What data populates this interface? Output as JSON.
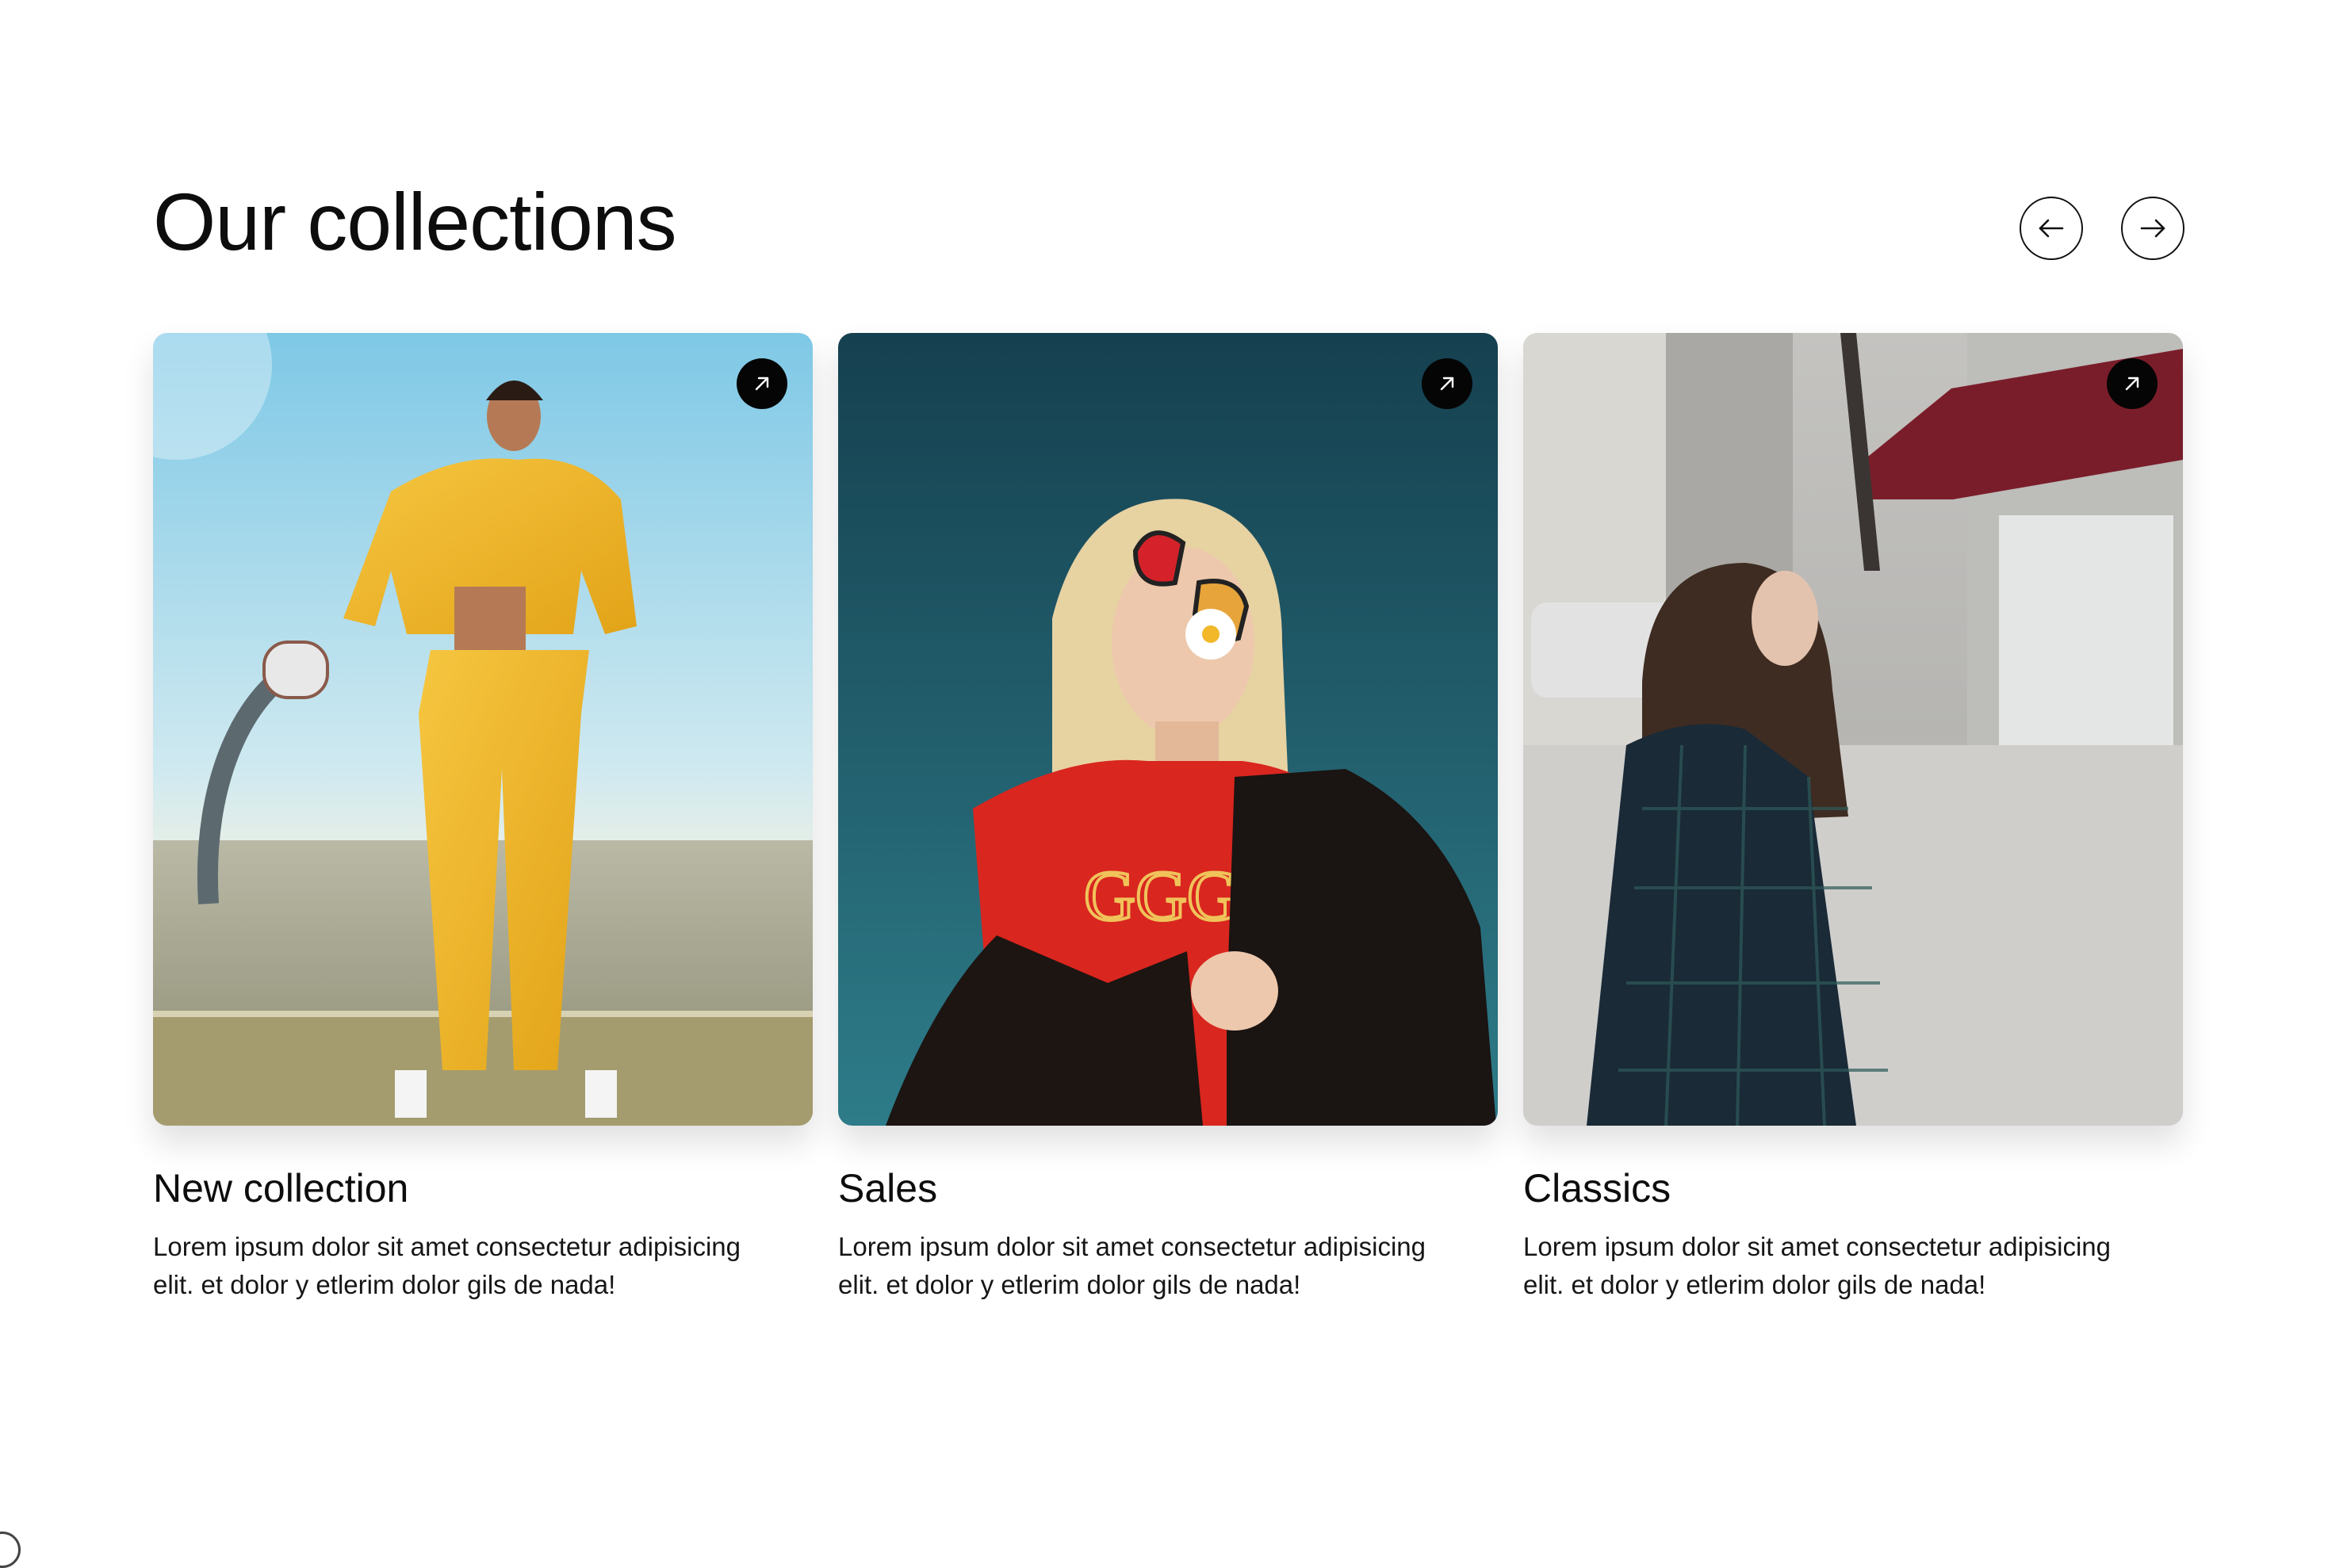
{
  "section": {
    "title": "Our collections",
    "prev_icon": "arrow-left-icon",
    "next_icon": "arrow-right-icon"
  },
  "cards": [
    {
      "title": "New collection",
      "description": "Lorem ipsum dolor sit amet consectetur adipisicing elit. et dolor y etlerim dolor gils de nada!",
      "badge_icon": "arrow-up-right-icon"
    },
    {
      "title": "Sales",
      "description": "Lorem ipsum dolor sit amet consectetur adipisicing elit. et dolor y etlerim dolor gils de nada!",
      "badge_icon": "arrow-up-right-icon"
    },
    {
      "title": "Classics",
      "description": "Lorem ipsum dolor sit amet consectetur adipisicing elit. et dolor y etlerim dolor gils de nada!",
      "badge_icon": "arrow-up-right-icon"
    }
  ],
  "colors": {
    "background": "#ffffff",
    "text": "#0d0d0d",
    "badge": "#050505"
  }
}
